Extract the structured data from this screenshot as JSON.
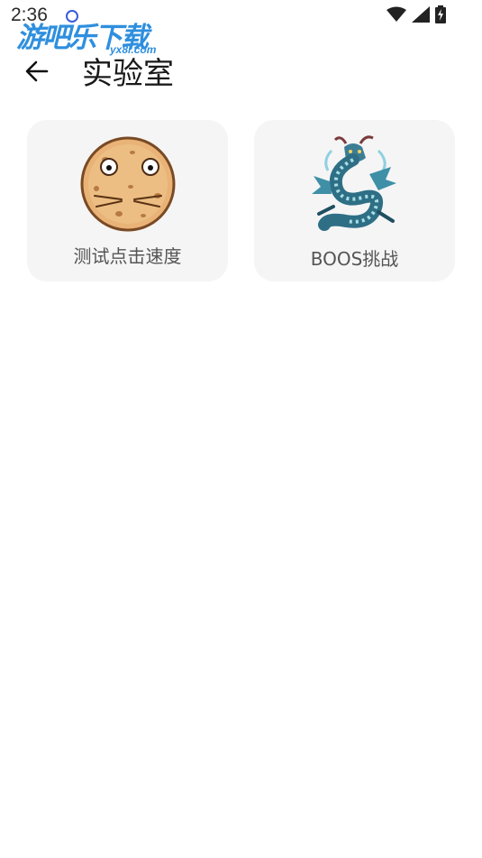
{
  "status_bar": {
    "time": "2:36",
    "icons": [
      "wifi-icon",
      "cell-signal-icon",
      "battery-charging-icon"
    ]
  },
  "watermark": {
    "main": "游吧乐下载",
    "sub": "yx8l.com"
  },
  "app_bar": {
    "back_icon": "arrow-left-icon",
    "title": "实验室"
  },
  "cards": [
    {
      "label": "测试点击速度",
      "icon": "cookie-face-image"
    },
    {
      "label": "BOOS挑战",
      "icon": "dragon-image"
    }
  ],
  "colors": {
    "card_bg": "#f5f5f5",
    "watermark": "#2f8fde",
    "cookie": "#e9b377",
    "dragon": "#2e6f86"
  }
}
